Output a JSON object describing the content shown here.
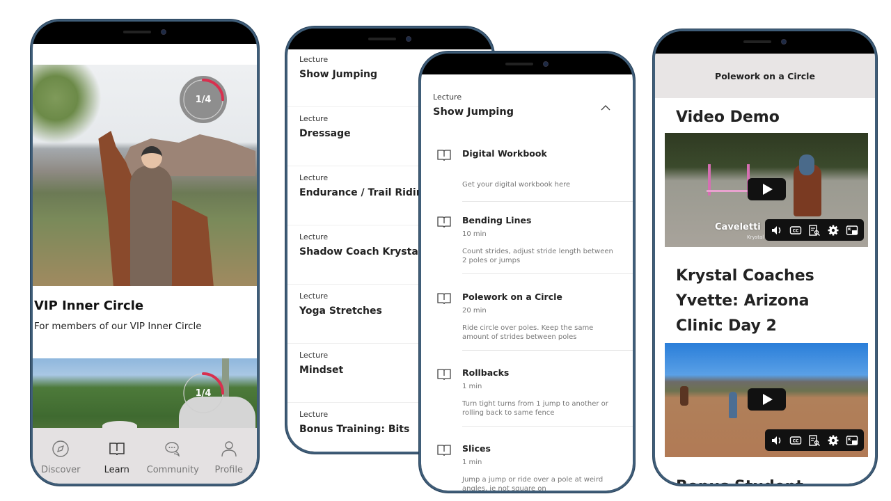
{
  "screen1": {
    "course": {
      "title": "VIP Inner Circle",
      "description": "For members of our VIP Inner Circle",
      "progress_label": "1/4",
      "progress_fraction": 0.25
    },
    "second_course": {
      "progress_label": "1/4",
      "progress_fraction": 0.25
    },
    "tabbar": {
      "items": [
        {
          "label": "Discover",
          "icon": "compass-icon",
          "active": false
        },
        {
          "label": "Learn",
          "icon": "book-open-icon",
          "active": true
        },
        {
          "label": "Community",
          "icon": "chat-bubbles-icon",
          "active": false
        },
        {
          "label": "Profile",
          "icon": "person-icon",
          "active": false
        }
      ]
    }
  },
  "screen2": {
    "lectures": [
      {
        "kicker": "Lecture",
        "title": "Show Jumping"
      },
      {
        "kicker": "Lecture",
        "title": "Dressage"
      },
      {
        "kicker": "Lecture",
        "title": "Endurance / Trail Riding"
      },
      {
        "kicker": "Lecture",
        "title": "Shadow Coach Krystal"
      },
      {
        "kicker": "Lecture",
        "title": "Yoga Stretches"
      },
      {
        "kicker": "Lecture",
        "title": "Mindset"
      },
      {
        "kicker": "Lecture",
        "title": "Bonus Training: Bits"
      }
    ]
  },
  "screen3": {
    "kicker": "Lecture",
    "title": "Show Jumping",
    "collapse_icon": "chevron-up-icon",
    "lessons": [
      {
        "title": "Digital Workbook",
        "duration": "",
        "description": "Get your digital workbook here"
      },
      {
        "title": "Bending Lines",
        "duration": "10 min",
        "description": "Count strides, adjust stride length between 2 poles or jumps"
      },
      {
        "title": "Polework on a Circle",
        "duration": "20 min",
        "description": "Ride circle over poles. Keep the same amount of strides between poles"
      },
      {
        "title": "Rollbacks",
        "duration": "1 min",
        "description": "Turn tight turns from 1 jump to another or rolling back to same fence"
      },
      {
        "title": "Slices",
        "duration": "1 min",
        "description": "Jump a jump or ride over a pole at weird angles, ie not square on"
      }
    ]
  },
  "screen4": {
    "header_title": "Polework on a Circle",
    "sections": [
      {
        "title": "Video Demo",
        "video_watermark": "Caveletti",
        "video_watermark_sub": "Krystal"
      },
      {
        "title": "Krystal Coaches Yvette: Arizona Clinic Day 2"
      }
    ],
    "cut_off_title": "Bonus Student",
    "video_controls": [
      "volume-icon",
      "captions-icon",
      "transcript-icon",
      "settings-icon",
      "picture-in-picture-icon"
    ]
  },
  "colors": {
    "progress_accent": "#d8304f",
    "frame": "#3f5d78",
    "tabbar_bg": "#e4e1e2",
    "header_bg": "#e8e5e5"
  }
}
